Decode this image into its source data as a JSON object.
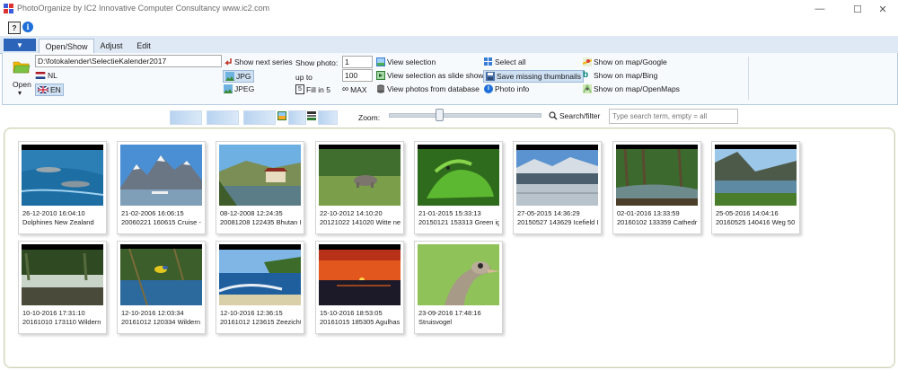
{
  "window": {
    "title": "PhotoOrganize by IC2 Innovative Computer Consultancy www.ic2.com",
    "minimize": "—",
    "maximize": "☐",
    "close": "✕"
  },
  "quick_access": {
    "help_label": "?",
    "info_label": "i"
  },
  "tabs": {
    "file_arrow": "▼",
    "items": [
      {
        "label": "Open/Show",
        "active": true
      },
      {
        "label": "Adjust",
        "active": false
      },
      {
        "label": "Edit",
        "active": false
      }
    ]
  },
  "ribbon": {
    "open_label": "Open",
    "open_arrow": "▾",
    "path_value": "D:\\fotokalender\\SelectieKalender2017",
    "lang_nl": "NL",
    "lang_en": "EN",
    "show_next_series": "Show next series",
    "jpg": "JPG",
    "jpeg": "JPEG",
    "show_photo_label": "Show photo:",
    "show_photo_value": "1",
    "up_to_label": "up to",
    "up_to_value": "100",
    "fill_in_5": "Fill in 5",
    "fill_icon_text": "5",
    "max_label": "MAX",
    "max_icon_text": "∞",
    "view_selection": "View selection",
    "view_slide_show": "View selection as slide show",
    "view_database": "View photos from database",
    "select_all": "Select all",
    "save_missing_thumbnails": "Save missing thumbnails",
    "photo_info": "Photo info",
    "map_google": "Show on map/Google",
    "map_bing": "Show on map/Bing",
    "map_openmaps": "Show on map/OpenMaps"
  },
  "toolbar": {
    "zoom_label": "Zoom:",
    "zoom_level": 0.33,
    "search_label": "Search/filter",
    "search_placeholder": "Type search term, empty = all"
  },
  "photos": [
    {
      "date": "26-12-2010 16:04:10",
      "name": "Dolphines New Zealand"
    },
    {
      "date": "21-02-2006 16:06:15",
      "name": "20060221 160615 Cruise - "
    },
    {
      "date": "08-12-2008 12:24:35",
      "name": "20081208 122435 Bhutan I"
    },
    {
      "date": "22-10-2012 14:10:20",
      "name": "20121022 141020 Witte ne"
    },
    {
      "date": "21-01-2015 15:33:13",
      "name": "20150121 153313 Green ig"
    },
    {
      "date": "27-05-2015 14:36:29",
      "name": "20150527 143629 Icefield I"
    },
    {
      "date": "02-01-2016 13:33:59",
      "name": "20160102 133359 Cathedr"
    },
    {
      "date": "25-05-2016 14:04:16",
      "name": "20160525 140416 Weg 50"
    },
    {
      "date": "10-10-2016 17:31:10",
      "name": "20161010 173110 Wildern"
    },
    {
      "date": "12-10-2016 12:03:34",
      "name": "20161012 120334 Wildern"
    },
    {
      "date": "12-10-2016 12:36:15",
      "name": "20161012 123615 Zeezicht"
    },
    {
      "date": "15-10-2016 18:53:05",
      "name": "20161015 185305 Agulhas"
    },
    {
      "date": "23-09-2016 17:48:16",
      "name": "Struisvogel"
    }
  ]
}
